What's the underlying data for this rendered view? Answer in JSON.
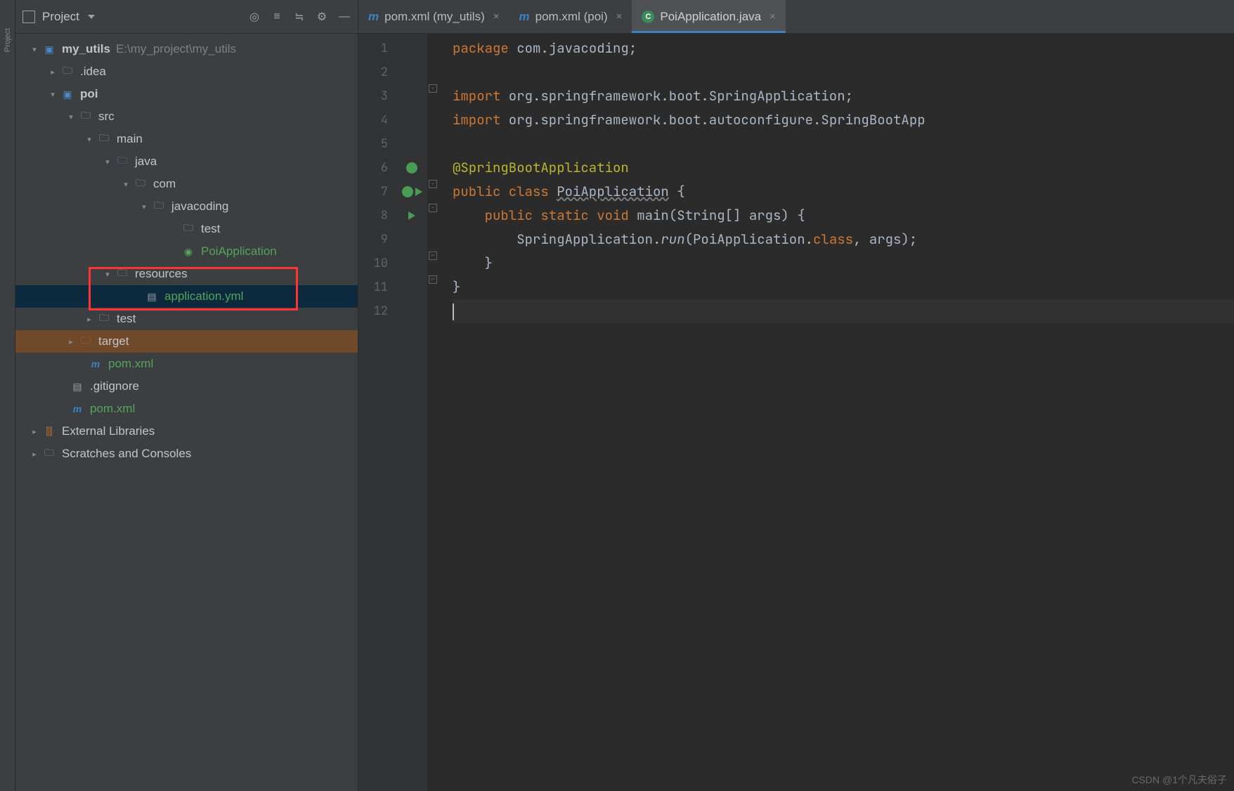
{
  "panel": {
    "title": "Project"
  },
  "tree": {
    "root": {
      "name": "my_utils",
      "path": "E:\\my_project\\my_utils"
    },
    "idea": ".idea",
    "poi": "poi",
    "src": "src",
    "main": "main",
    "java": "java",
    "com": "com",
    "javacoding": "javacoding",
    "test_pkg": "test",
    "poi_app": "PoiApplication",
    "resources": "resources",
    "app_yml": "application.yml",
    "test_dir": "test",
    "target": "target",
    "pom_poi": "pom.xml",
    "gitignore": ".gitignore",
    "pom_root": "pom.xml",
    "ext_lib": "External Libraries",
    "scratches": "Scratches and Consoles"
  },
  "tabs": {
    "t1": "pom.xml (my_utils)",
    "t2": "pom.xml (poi)",
    "t3": "PoiApplication.java"
  },
  "code": {
    "ln": [
      "1",
      "2",
      "3",
      "4",
      "5",
      "6",
      "7",
      "8",
      "9",
      "10",
      "11",
      "12"
    ],
    "l1a": "package",
    "l1b": " com.javacoding;",
    "l3a": "import",
    "l3b": " org.springframework.boot.SpringApplication;",
    "l4a": "import",
    "l4b": " org.springframework.boot.autoconfigure.",
    "l4c": "SpringBootApp",
    "l6": "@SpringBootApplication",
    "l7a": "public class ",
    "l7b": "PoiApplication",
    "l7c": " {",
    "l8a": "    public static ",
    "l8b": "void",
    "l8c": " main(String[] args) {",
    "l9a": "        SpringApplication.",
    "l9b": "run",
    "l9c": "(PoiApplication.",
    "l9d": "class",
    "l9e": ", args);",
    "l10": "    }",
    "l11": "}",
    "l12": ""
  },
  "watermark": "CSDN @1个凡夫俗子"
}
